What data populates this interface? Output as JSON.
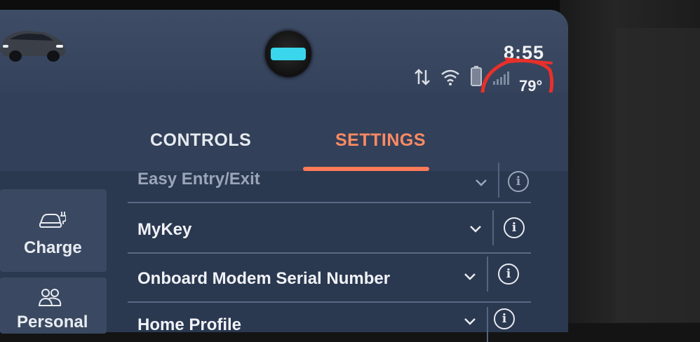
{
  "status": {
    "clock": "8:55",
    "temperature": "79°"
  },
  "tabs": [
    {
      "label": "CONTROLS",
      "selected": false
    },
    {
      "label": "SETTINGS",
      "selected": true
    }
  ],
  "sidebar": {
    "items": [
      {
        "label": "Charge",
        "icon": "car-charge-icon"
      },
      {
        "label": "Personal",
        "icon": "people-icon"
      }
    ]
  },
  "settings_list": [
    {
      "label": "Easy Entry/Exit"
    },
    {
      "label": "MyKey"
    },
    {
      "label": "Onboard Modem Serial Number"
    },
    {
      "label": "Home Profile"
    }
  ],
  "colors": {
    "accent": "#ff7a58",
    "screen_bg": "#2c3a52",
    "annotation": "#e8302a"
  }
}
